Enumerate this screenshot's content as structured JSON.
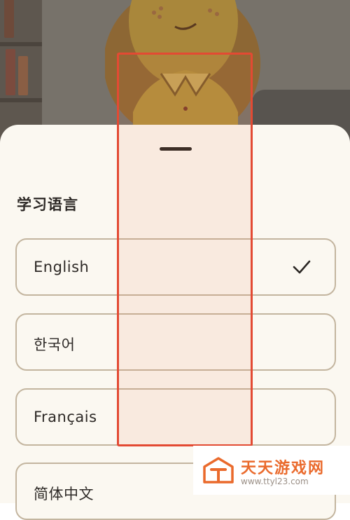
{
  "sheet": {
    "title": "学习语言",
    "options": [
      {
        "label": "English",
        "selected": true
      },
      {
        "label": "한국어",
        "selected": false
      },
      {
        "label": "Français",
        "selected": false
      },
      {
        "label": "简体中文",
        "selected": false
      }
    ]
  },
  "icons": {
    "check": "check-icon",
    "drag_handle": "drag-handle-icon",
    "watermark_logo": "watermark-logo-icon"
  },
  "colors": {
    "sheet_bg": "#fbf8f1",
    "option_border": "#c3b59f",
    "highlight": "#e34a33",
    "watermark": "#ea6a2c"
  },
  "watermark": {
    "title": "天天游戏网",
    "url": "www.ttyl23.com"
  }
}
